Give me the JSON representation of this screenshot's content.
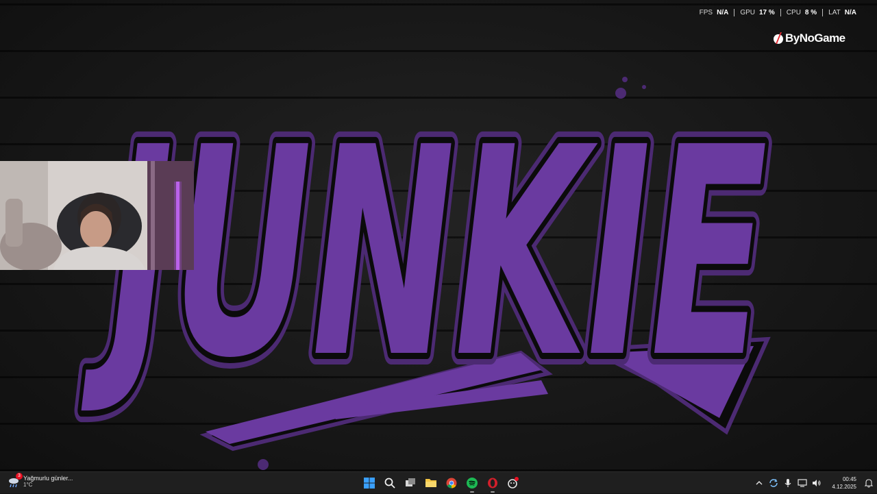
{
  "overlay": {
    "stats": [
      {
        "label": "FPS",
        "value": "N/A"
      },
      {
        "label": "GPU",
        "value": "17 %"
      },
      {
        "label": "CPU",
        "value": "8 %"
      },
      {
        "label": "LAT",
        "value": "N/A"
      }
    ],
    "brand": "ByNoGame"
  },
  "wallpaper": {
    "logo_text": "JUNKIE",
    "colors": {
      "fill": "#6a3aa0",
      "outline": "#4c2a73",
      "background": "#171717"
    }
  },
  "webcam": {
    "icon": "webcam-feed"
  },
  "taskbar": {
    "weather": {
      "title": "Yağmurlu günler...",
      "temp": "1°C",
      "badge": "3",
      "icon": "cloud-rain-icon"
    },
    "apps": [
      {
        "name": "start",
        "icon": "windows-icon"
      },
      {
        "name": "search",
        "icon": "search-icon"
      },
      {
        "name": "task-view",
        "icon": "task-view-icon"
      },
      {
        "name": "file-explorer",
        "icon": "folder-icon"
      },
      {
        "name": "chrome",
        "icon": "chrome-icon"
      },
      {
        "name": "spotify",
        "icon": "spotify-icon"
      },
      {
        "name": "opera",
        "icon": "opera-icon"
      },
      {
        "name": "app",
        "icon": "app-icon"
      }
    ],
    "tray": {
      "icons": [
        "chevron-up-icon",
        "sync-icon",
        "microphone-icon",
        "display-icon",
        "speaker-icon"
      ],
      "time": "00:45",
      "date": "4.12.2025"
    }
  }
}
